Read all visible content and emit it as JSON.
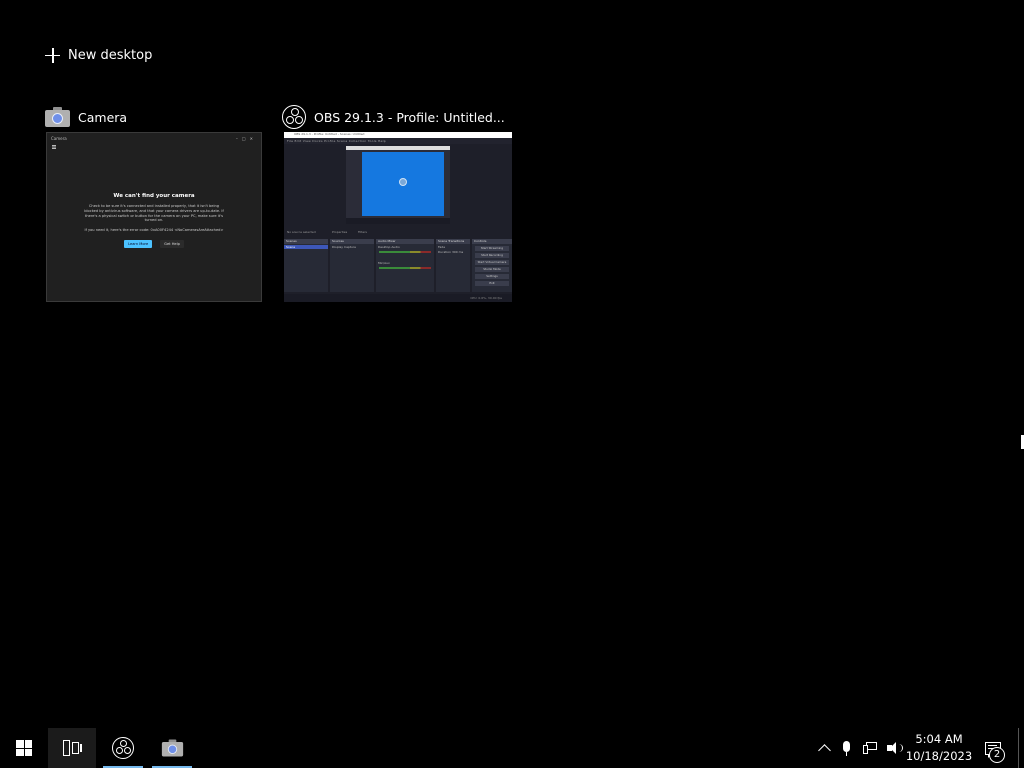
{
  "new_desktop": {
    "label": "New desktop"
  },
  "windows": [
    {
      "title": "Camera",
      "icon": "camera-icon",
      "thumbnail": {
        "window_title": "Camera",
        "heading": "We can't find your camera",
        "body": "Check to be sure it's connected and installed properly, that it isn't being blocked by antivirus software, and that your camera drivers are up-to-date. If there's a physical switch or button for the camera on your PC, make sure it's turned on.",
        "error_text": "If you need it, here's the error code: 0xA00F4244 <NoCamerasAreAttached>",
        "primary_button": "Learn More",
        "secondary_button": "Get Help"
      }
    },
    {
      "title": "OBS 29.1.3 - Profile: Untitled...",
      "icon": "obs-icon",
      "thumbnail": {
        "window_title": "OBS 29.1.3 - Profile: Untitled - Scenes: Untitled",
        "menu": "File  Edit  View  Docks  Profile  Scene Collection  Tools  Help",
        "no_source": "No source selected",
        "properties": "Properties",
        "filters": "Filters",
        "docks": {
          "scenes": {
            "header": "Scenes",
            "items": [
              "Scene"
            ]
          },
          "sources": {
            "header": "Sources",
            "items": [
              "Display Capture"
            ]
          },
          "audio": {
            "header": "Audio Mixer",
            "items": [
              "Desktop Audio",
              "Mic/Aux"
            ]
          },
          "transitions": {
            "header": "Scene Transitions",
            "items": [
              "Fade",
              "Duration 300 ms"
            ]
          },
          "controls": {
            "header": "Controls",
            "items": [
              "Start Streaming",
              "Start Recording",
              "Start Virtual Camera",
              "Studio Mode",
              "Settings",
              "Exit"
            ]
          }
        },
        "status": "CPU: 0.6%, 30.00 fps"
      }
    }
  ],
  "taskbar": {
    "items": [
      {
        "name": "start",
        "icon": "windows-logo-icon"
      },
      {
        "name": "task-view",
        "icon": "task-view-icon",
        "active": true
      },
      {
        "name": "obs",
        "icon": "obs-icon",
        "running": true
      },
      {
        "name": "camera",
        "icon": "camera-icon",
        "running": true
      }
    ],
    "tray": {
      "icons": [
        "chevron-up-icon",
        "microphone-icon",
        "network-icon",
        "volume-icon"
      ],
      "time": "5:04 AM",
      "date": "10/18/2023",
      "notification_count": "2"
    },
    "accent_color": "#76b9ed"
  },
  "colors": {
    "background": "#000000",
    "obs_preview": "#1578e0",
    "camera_button": "#4cc2ff"
  }
}
